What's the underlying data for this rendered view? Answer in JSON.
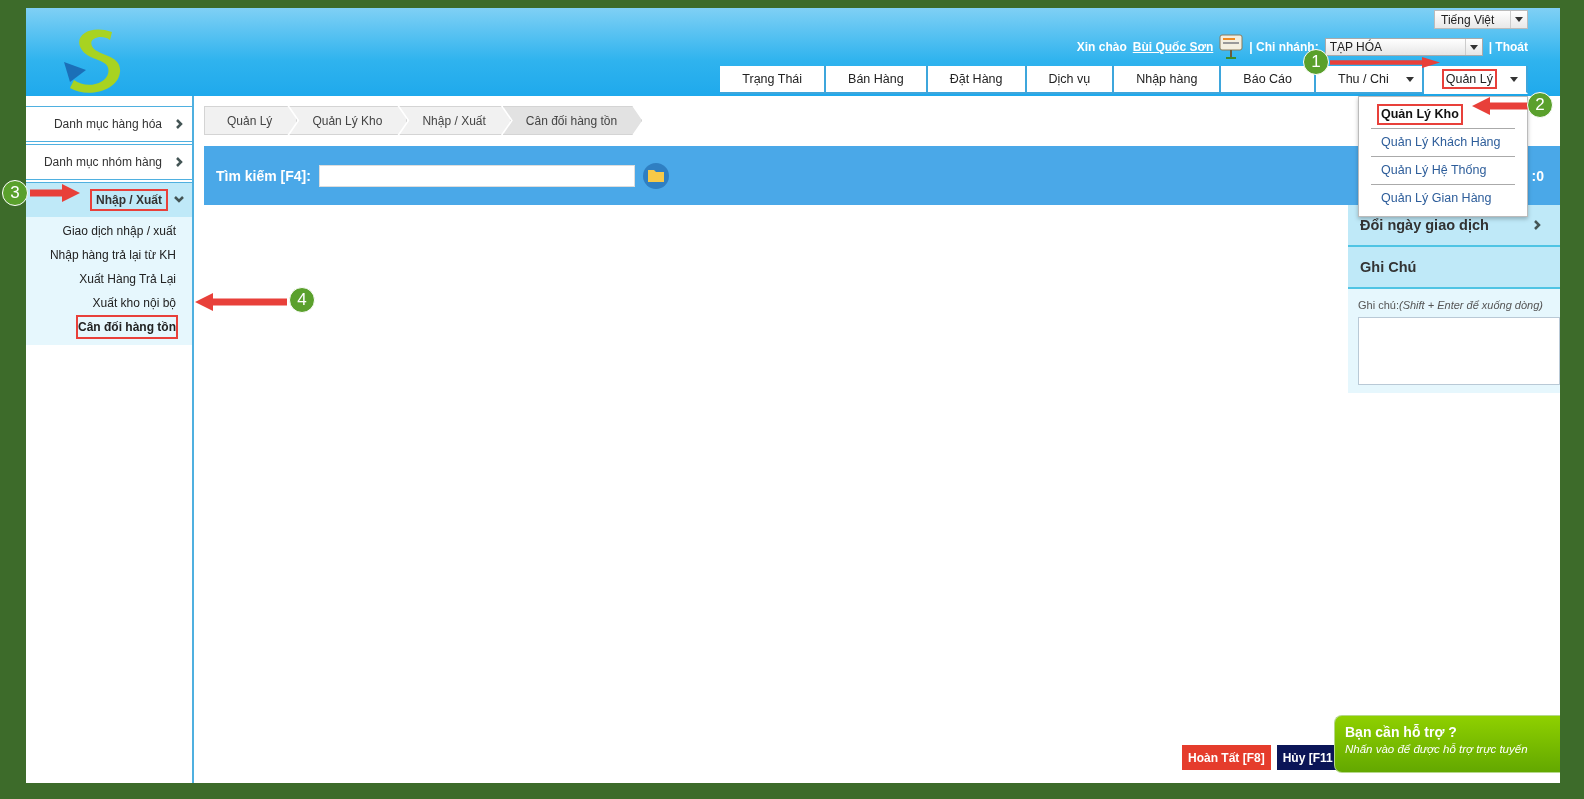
{
  "language": "Tiếng Việt",
  "greeting": {
    "label": "Xin chào",
    "user": "Bùi Quốc Sơn"
  },
  "branch": {
    "label": "| Chi nhánh:",
    "value": "TẠP HÓA"
  },
  "logout": "| Thoát",
  "tabs": [
    {
      "label": "Trạng Thái",
      "selected": false,
      "dropdown": false,
      "annotated": false
    },
    {
      "label": "Bán Hàng",
      "selected": false,
      "dropdown": false,
      "annotated": false
    },
    {
      "label": "Đặt Hàng",
      "selected": false,
      "dropdown": false,
      "annotated": false
    },
    {
      "label": "Dịch vụ",
      "selected": false,
      "dropdown": false,
      "annotated": false
    },
    {
      "label": "Nhập hàng",
      "selected": false,
      "dropdown": false,
      "annotated": false
    },
    {
      "label": "Báo Cáo",
      "selected": false,
      "dropdown": false,
      "annotated": false
    },
    {
      "label": "Thu / Chi",
      "selected": false,
      "dropdown": true,
      "annotated": false
    },
    {
      "label": "Quản Lý",
      "selected": true,
      "dropdown": true,
      "annotated": true
    }
  ],
  "menu": [
    {
      "label": "Quản Lý Kho",
      "selected": true,
      "annotated": true
    },
    {
      "label": "Quản Lý Khách Hàng",
      "selected": false,
      "annotated": false
    },
    {
      "label": "Quản Lý Hệ Thống",
      "selected": false,
      "annotated": false
    },
    {
      "label": "Quản Lý Gian Hàng",
      "selected": false,
      "annotated": false
    }
  ],
  "sidebar": [
    {
      "label": "Danh mục hàng hóa",
      "expanded": false,
      "annotated": false
    },
    {
      "label": "Danh mục nhóm hàng",
      "expanded": false,
      "annotated": false
    },
    {
      "label": "Nhập / Xuất",
      "expanded": true,
      "annotated": true,
      "children": [
        {
          "label": "Giao dịch nhập / xuất",
          "selected": false,
          "annotated": false
        },
        {
          "label": "Nhập hàng trả lại từ KH",
          "selected": false,
          "annotated": false
        },
        {
          "label": "Xuất Hàng Trả Lại",
          "selected": false,
          "annotated": false
        },
        {
          "label": "Xuất kho nội bộ",
          "selected": false,
          "annotated": false
        },
        {
          "label": "Cân đối hàng tồn",
          "selected": true,
          "annotated": true
        }
      ]
    }
  ],
  "breadcrumb": [
    "Quản Lý",
    "Quản Lý Kho",
    "Nhập / Xuất",
    "Cân đối hàng tồn"
  ],
  "search": {
    "label": "Tìm kiếm [F4]:"
  },
  "summary": ":0",
  "right_panel": {
    "sections": [
      {
        "title": "Đổi ngày giao dịch",
        "kind": "link"
      },
      {
        "title": "Ghi Chú",
        "kind": "header"
      }
    ],
    "note_label": "Ghi chú:*(Shift + Enter để xuống dòng)*"
  },
  "buttons": [
    {
      "label": "Hoàn Tất [F8]",
      "kind": "primary"
    },
    {
      "label": "Hủy [F11",
      "kind": "secondary"
    }
  ],
  "help": {
    "title": "Bạn cần hỗ trợ ?",
    "subtitle": "Nhấn vào để được hỗ trợ trực tuyến"
  },
  "annotations": [
    {
      "number": "1"
    },
    {
      "number": "2"
    },
    {
      "number": "3"
    },
    {
      "number": "4"
    }
  ]
}
